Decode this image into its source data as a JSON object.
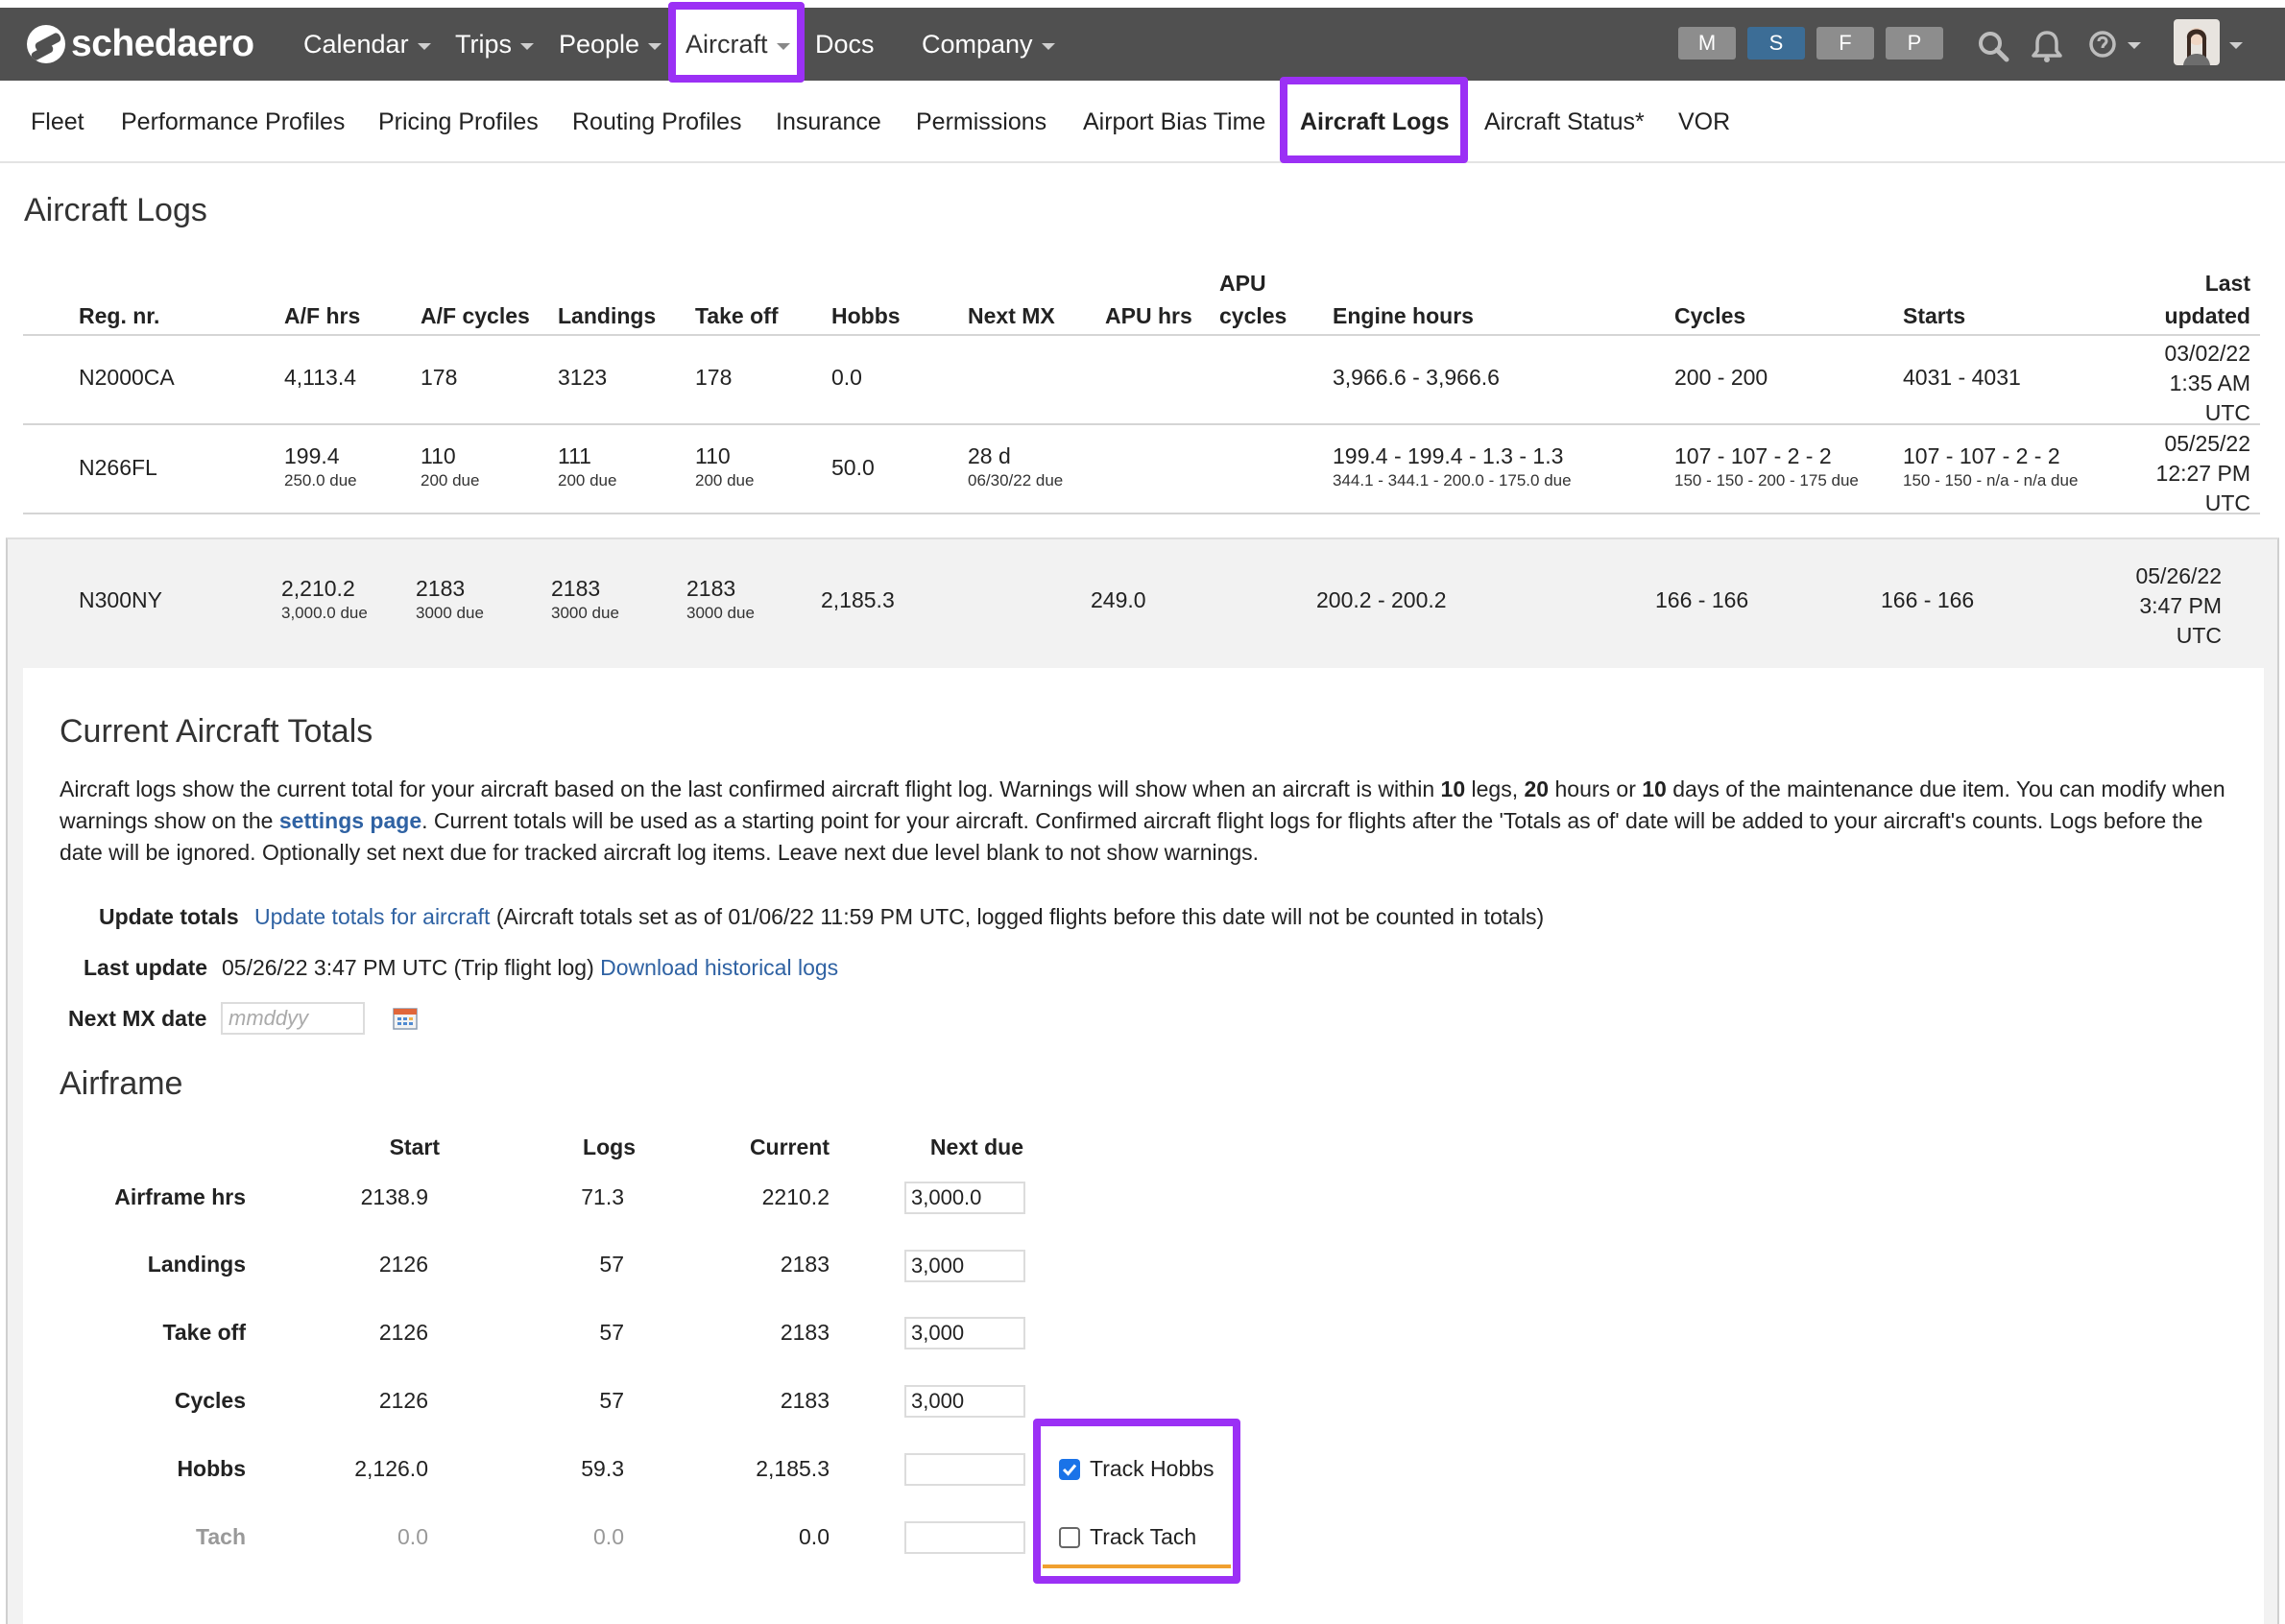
{
  "app": {
    "brand": "schedaero",
    "accent_color": "#9b30f5"
  },
  "top_nav": {
    "items": [
      {
        "label": "Calendar",
        "has_dropdown": true
      },
      {
        "label": "Trips",
        "has_dropdown": true
      },
      {
        "label": "People",
        "has_dropdown": true
      },
      {
        "label": "Aircraft",
        "has_dropdown": true,
        "active": true
      },
      {
        "label": "Docs",
        "has_dropdown": false
      },
      {
        "label": "Company",
        "has_dropdown": true
      }
    ],
    "role_buttons": [
      "M",
      "S",
      "F",
      "P"
    ],
    "icons": [
      "search-icon",
      "bell-icon",
      "help-icon",
      "user-avatar"
    ]
  },
  "sub_nav": {
    "items": [
      "Fleet",
      "Performance Profiles",
      "Pricing Profiles",
      "Routing Profiles",
      "Insurance",
      "Permissions",
      "Airport Bias Time",
      "Aircraft Logs",
      "Aircraft Status*",
      "VOR"
    ],
    "active": "Aircraft Logs"
  },
  "page": {
    "title": "Aircraft Logs"
  },
  "logs_table": {
    "headers": {
      "reg": "Reg. nr.",
      "af_hrs": "A/F hrs",
      "af_cycles": "A/F cycles",
      "landings": "Landings",
      "take_off": "Take off",
      "hobbs": "Hobbs",
      "next_mx": "Next MX",
      "apu_hrs": "APU hrs",
      "apu_cycles_1": "APU",
      "apu_cycles_2": "cycles",
      "engine_hours": "Engine hours",
      "cycles": "Cycles",
      "starts": "Starts",
      "last_updated_1": "Last",
      "last_updated_2": "updated"
    },
    "rows": [
      {
        "reg": "N2000CA",
        "af_hrs": "4,113.4",
        "af_hrs_due": "",
        "af_cycles": "178",
        "af_cycles_due": "",
        "landings": "3123",
        "landings_due": "",
        "take_off": "178",
        "take_off_due": "",
        "hobbs": "0.0",
        "next_mx": "",
        "next_mx_due": "",
        "apu_hrs": "",
        "apu_cycles": "",
        "engine_hours": "3,966.6 - 3,966.6",
        "engine_hours_due": "",
        "cycles": "200 - 200",
        "cycles_due": "",
        "starts": "4031 - 4031",
        "starts_due": "",
        "updated_date": "03/02/22",
        "updated_time": "1:35 AM",
        "updated_tz": "UTC"
      },
      {
        "reg": "N266FL",
        "af_hrs": "199.4",
        "af_hrs_due": "250.0 due",
        "af_cycles": "110",
        "af_cycles_due": "200 due",
        "landings": "111",
        "landings_due": "200 due",
        "take_off": "110",
        "take_off_due": "200 due",
        "hobbs": "50.0",
        "next_mx": "28 d",
        "next_mx_due": "06/30/22 due",
        "apu_hrs": "",
        "apu_cycles": "",
        "engine_hours": "199.4 - 199.4 - 1.3 - 1.3",
        "engine_hours_due": "344.1 - 344.1 - 200.0 - 175.0 due",
        "cycles": "107 - 107 - 2 - 2",
        "cycles_due": "150 - 150 - 200 - 175 due",
        "starts": "107 - 107 - 2 - 2",
        "starts_due": "150 - 150 - n/a - n/a due",
        "updated_date": "05/25/22",
        "updated_time": "12:27 PM",
        "updated_tz": "UTC"
      },
      {
        "reg": "N300NY",
        "af_hrs": "2,210.2",
        "af_hrs_due": "3,000.0 due",
        "af_cycles": "2183",
        "af_cycles_due": "3000 due",
        "landings": "2183",
        "landings_due": "3000 due",
        "take_off": "2183",
        "take_off_due": "3000 due",
        "hobbs": "2,185.3",
        "next_mx": "",
        "next_mx_due": "",
        "apu_hrs": "249.0",
        "apu_cycles": "",
        "engine_hours": "200.2 - 200.2",
        "engine_hours_due": "",
        "cycles": "166 - 166",
        "cycles_due": "",
        "starts": "166 - 166",
        "starts_due": "",
        "updated_date": "05/26/22",
        "updated_time": "3:47 PM",
        "updated_tz": "UTC",
        "expanded": true
      }
    ]
  },
  "totals": {
    "title": "Current Aircraft Totals",
    "intro": {
      "p1": "Aircraft logs show the current total for your aircraft based on the last confirmed aircraft flight log. Warnings will show when an aircraft is within ",
      "legs": "10",
      "p2": " legs, ",
      "hours": "20",
      "p3": " hours or ",
      "days": "10",
      "p4": " days of the maintenance due item. You can modify when warnings show on the ",
      "settings_link": "settings page",
      "p5": ". Current totals will be used as a starting point for your aircraft. Confirmed aircraft flight logs for flights after the 'Totals as of' date will be added to your aircraft's counts. Logs before the date will be ignored. Optionally set next due for tracked aircraft log items. Leave next due level blank to not show warnings."
    },
    "update_totals_label": "Update totals",
    "update_totals_link": "Update totals for aircraft",
    "update_totals_note": "(Aircraft totals set as of 01/06/22 11:59 PM UTC, logged flights before this date will not be counted in totals)",
    "last_update_label": "Last update",
    "last_update_value": "05/26/22 3:47 PM UTC (Trip flight log)",
    "download_link": "Download historical logs",
    "next_mx_label": "Next MX date",
    "next_mx_placeholder": "mmddyy"
  },
  "airframe": {
    "title": "Airframe",
    "headers": {
      "start": "Start",
      "logs": "Logs",
      "current": "Current",
      "next_due": "Next due"
    },
    "rows": [
      {
        "label": "Airframe hrs",
        "start": "2138.9",
        "logs": "71.3",
        "current": "2210.2",
        "next_due": "3,000.0"
      },
      {
        "label": "Landings",
        "start": "2126",
        "logs": "57",
        "current": "2183",
        "next_due": "3,000"
      },
      {
        "label": "Take off",
        "start": "2126",
        "logs": "57",
        "current": "2183",
        "next_due": "3,000"
      },
      {
        "label": "Cycles",
        "start": "2126",
        "logs": "57",
        "current": "2183",
        "next_due": "3,000"
      },
      {
        "label": "Hobbs",
        "start": "2,126.0",
        "logs": "59.3",
        "current": "2,185.3",
        "next_due": "",
        "track_label": "Track Hobbs",
        "tracked": true
      },
      {
        "label": "Tach",
        "start": "0.0",
        "logs": "0.0",
        "current": "0.0",
        "next_due": "",
        "track_label": "Track Tach",
        "tracked": false
      }
    ]
  }
}
